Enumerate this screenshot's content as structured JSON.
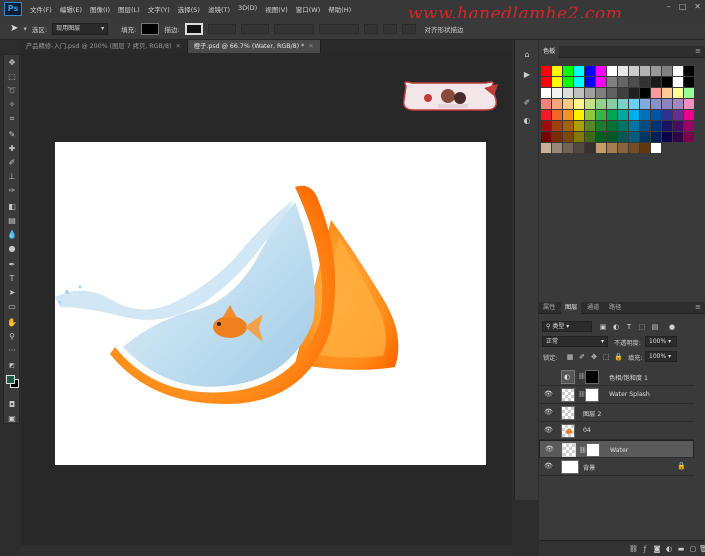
{
  "app": {
    "logo": "Ps"
  },
  "menu": [
    "文件(F)",
    "编辑(E)",
    "图像(I)",
    "图层(L)",
    "文字(Y)",
    "选择(S)",
    "滤镜(T)",
    "3D(D)",
    "视图(V)",
    "窗口(W)",
    "帮助(H)"
  ],
  "watermark": "www.hanedlamhe2.com",
  "options": {
    "select_label": "选区:",
    "select_value": "现用图层",
    "fill_label": "填充:",
    "stroke_label": "描边:",
    "right_label": "对齐形状描边"
  },
  "tabs": [
    {
      "label": "产品精修-入门.psd @ 200% (图层 7 拷贝, RGB/8)",
      "active": false
    },
    {
      "label": "橙子.psd @ 66.7% (Water, RGB/8) *",
      "active": true
    }
  ],
  "swatches_panel": {
    "title": "色板"
  },
  "swatches": [
    [
      "#ff0000",
      "#ffff00",
      "#00ff00",
      "#00ffff",
      "#0000ff",
      "#ff00ff",
      "#ffffff",
      "#e6e6e6",
      "#cccccc",
      "#b3b3b3",
      "#999999",
      "#808080",
      "#ffffff",
      "#000000"
    ],
    [
      "#ff0000",
      "#ffff00",
      "#00ff00",
      "#00ffff",
      "#0000ff",
      "#ff00ff",
      "#808080",
      "#666666",
      "#4d4d4d",
      "#333333",
      "#1a1a1a",
      "#000000",
      "#ffffff",
      "#000000"
    ],
    [
      "#ffffff",
      "#f2f2f2",
      "#dcdcdc",
      "#c0c0c0",
      "#a0a0a0",
      "#808080",
      "#606060",
      "#404040",
      "#202020",
      "#000000",
      "#ff9999",
      "#ffcc99",
      "#ffff99",
      "#99ff99"
    ],
    [
      "#f4827a",
      "#f7a57a",
      "#fcc97f",
      "#fff58a",
      "#c7e087",
      "#91d08f",
      "#86cfa5",
      "#7bcfc9",
      "#6ccff6",
      "#82aade",
      "#8492c9",
      "#8b84c0",
      "#a387be",
      "#f08fbe"
    ],
    [
      "#ed1c24",
      "#f26522",
      "#f7941d",
      "#fff200",
      "#8dc63f",
      "#39b54a",
      "#00a651",
      "#00a99d",
      "#00aeef",
      "#0072bc",
      "#0054a6",
      "#2e3192",
      "#662d91",
      "#ec008c"
    ],
    [
      "#9e0b0f",
      "#a0410d",
      "#a36209",
      "#aba000",
      "#598527",
      "#197b30",
      "#007236",
      "#00746b",
      "#0076a3",
      "#004b80",
      "#003471",
      "#1b1464",
      "#440e62",
      "#9e005d"
    ],
    [
      "#790000",
      "#7b2e00",
      "#7d4900",
      "#827b00",
      "#406618",
      "#005e20",
      "#005826",
      "#005952",
      "#005b7f",
      "#003663",
      "#002157",
      "#0d004c",
      "#32004b",
      "#7b0046"
    ],
    [
      "#c7b299",
      "#998675",
      "#736357",
      "#534741",
      "#37302d",
      "#c69c6d",
      "#a67c52",
      "#8c6239",
      "#754c24",
      "#603913",
      "#ffffff",
      "#3a3a3a",
      "#3a3a3a",
      "#3a3a3a"
    ]
  ],
  "layers_panel": {
    "tabs": [
      "属性",
      "图层",
      "通道",
      "路径"
    ],
    "filter": "类型",
    "blend_mode": "正常",
    "opacity_label": "不透明度:",
    "opacity_value": "100%",
    "lock_label": "锁定:",
    "fill_label": "填充:",
    "fill_value": "100%"
  },
  "layers": [
    {
      "name": "色相/饱和度 1",
      "visible": false,
      "type": "adjustment",
      "selected": false
    },
    {
      "name": "Water Splash",
      "visible": true,
      "type": "masked",
      "selected": false
    },
    {
      "name": "图层 2",
      "visible": true,
      "type": "pixel",
      "selected": false
    },
    {
      "name": "04",
      "visible": true,
      "type": "pixel",
      "selected": false
    },
    {
      "name": "Water",
      "visible": true,
      "type": "masked",
      "selected": true
    },
    {
      "name": "背景",
      "visible": true,
      "type": "background",
      "selected": false
    }
  ],
  "colors": {
    "accent": "#31a8ff",
    "foreground": "#1e5c4a",
    "background": "#ffffff"
  }
}
